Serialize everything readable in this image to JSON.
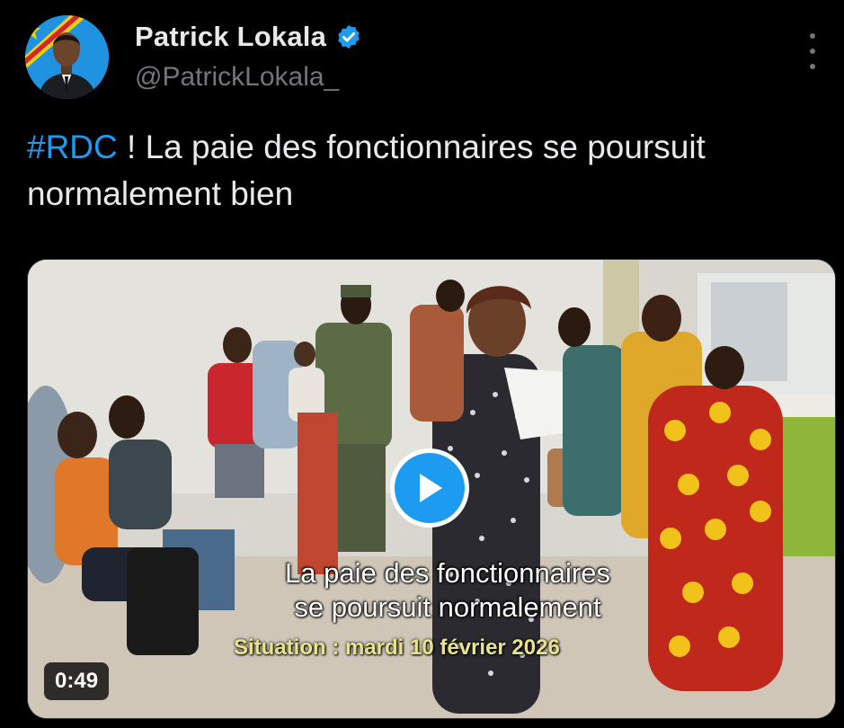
{
  "author": {
    "display_name": "Patrick Lokala",
    "handle": "@PatrickLokala_",
    "verified": true
  },
  "tweet": {
    "hashtag": "#RDC",
    "text": " ! La paie des fonctionnaires se poursuit normalement bien"
  },
  "media": {
    "caption_line1": "La paie des fonctionnaires",
    "caption_line2": "se poursuit normalement",
    "situation": "Situation : mardi 10 février 2026",
    "duration": "0:49"
  },
  "colors": {
    "background": "#000000",
    "accent": "#1d9bf0",
    "text": "#e7e9ea",
    "secondary": "#71767b"
  },
  "icons": {
    "verified": "verified-badge-icon",
    "more": "more-options-icon",
    "play": "play-icon"
  }
}
